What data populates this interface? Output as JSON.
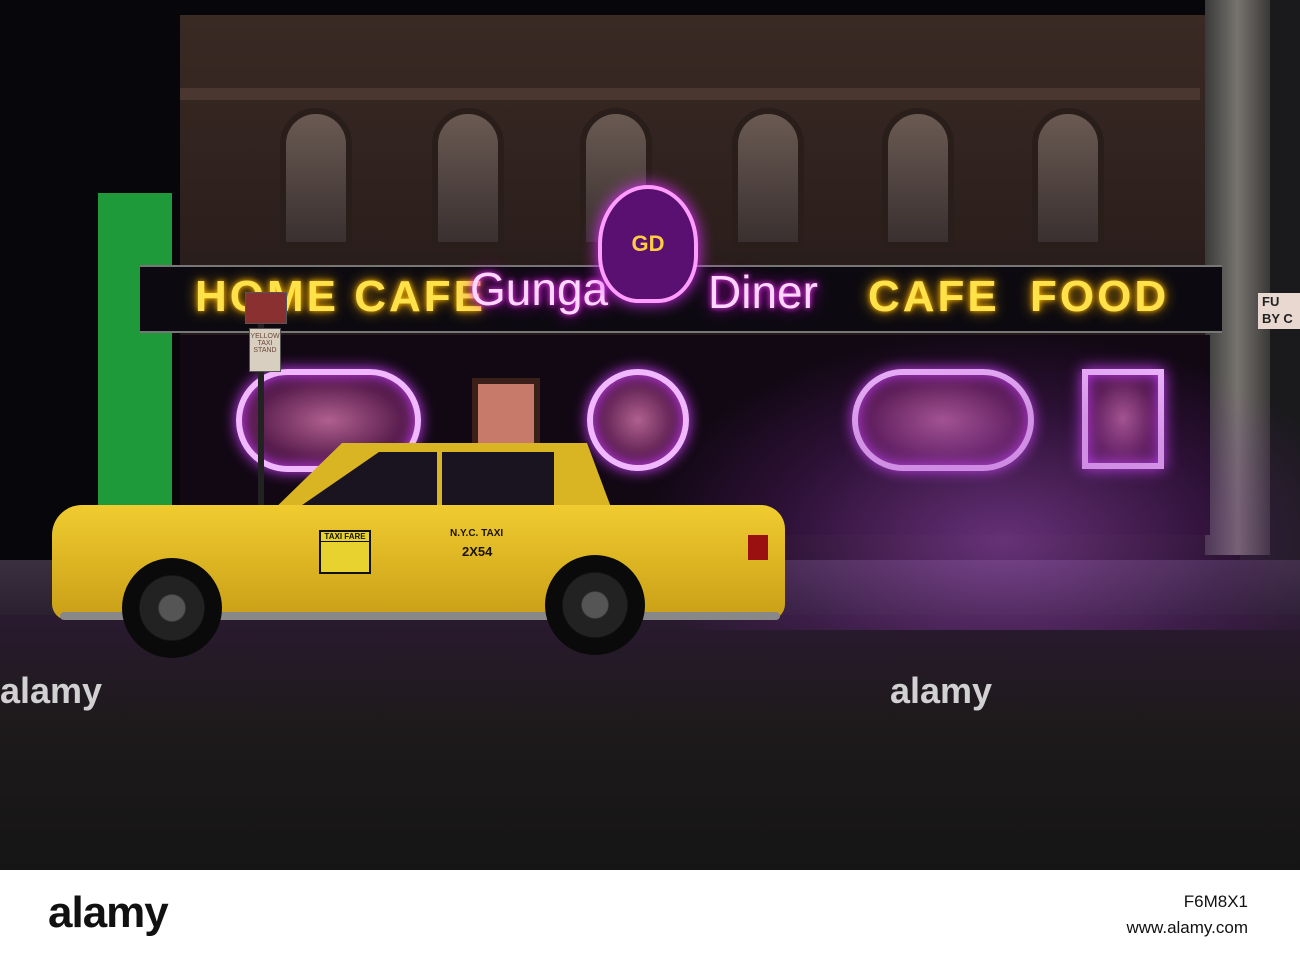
{
  "signs": {
    "left": "HOME CAFE",
    "center_left": "Gunga",
    "center_right": "Diner",
    "logo_monogram": "GD",
    "right_cafe": "CAFE",
    "right_food": "FOOD",
    "street_sign": "YELLOW TAXI STAND",
    "edge_sign": "FU BY C"
  },
  "taxi": {
    "label": "N.Y.C. TAXI",
    "number": "2X54",
    "fare_title": "TAXI FARE"
  },
  "watermark": {
    "overlay": "alamy",
    "logo": "alamy",
    "image_id": "F6M8X1",
    "url": "www.alamy.com"
  }
}
